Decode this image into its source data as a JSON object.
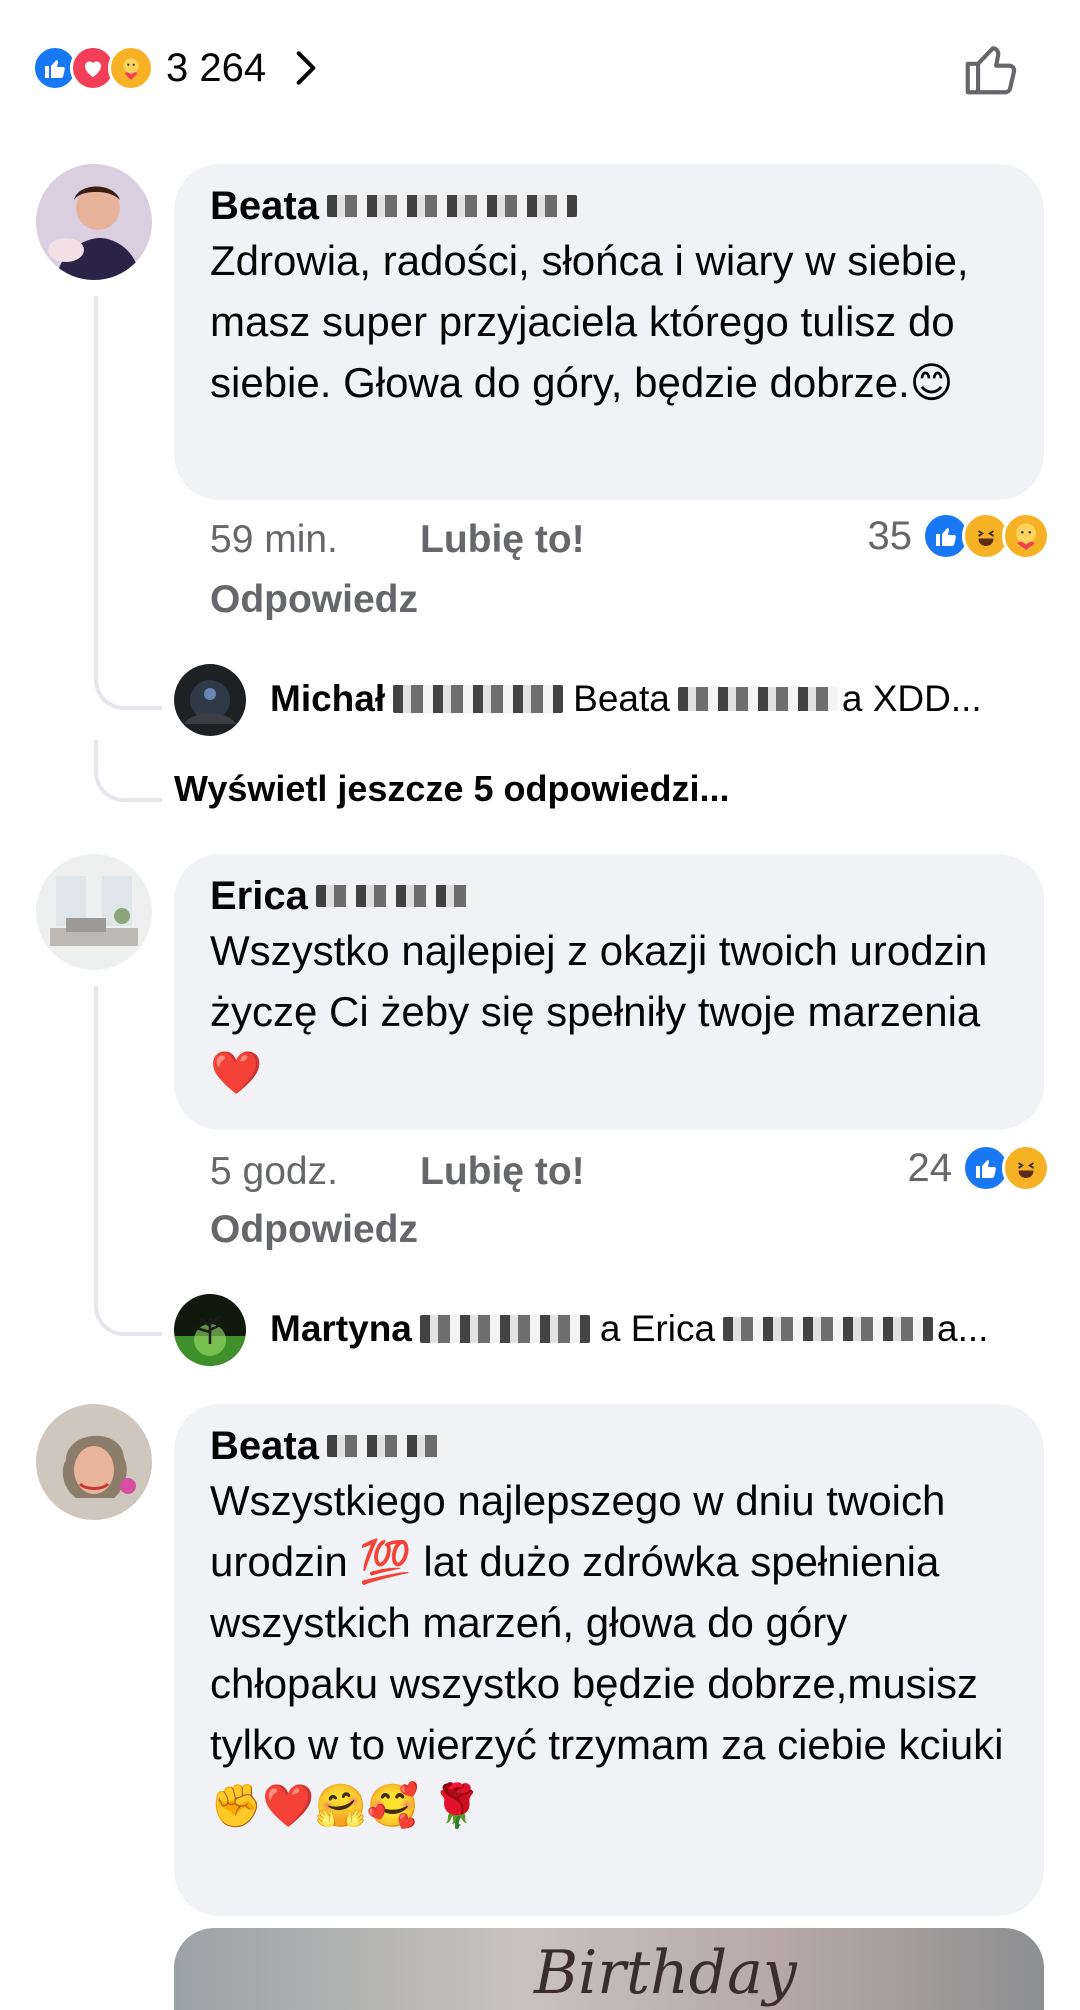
{
  "top": {
    "reaction_count": "3 264",
    "reaction_icons": [
      "like-icon",
      "love-icon",
      "care-icon"
    ]
  },
  "comments": [
    {
      "author": "Beata",
      "text": "Zdrowia, radości, słońca i wiary w siebie, masz super przyjaciela którego tulisz do siebie. Głowa do góry, będzie dobrze.😊",
      "time": "59 min.",
      "like_label": "Lubię to!",
      "reply_label": "Odpowiedz",
      "reaction_count": "35",
      "reply": {
        "name": "Michał",
        "text": "Beata",
        "tail": "a XDD..."
      },
      "more_replies": "Wyświetl jeszcze 5 odpowiedzi..."
    },
    {
      "author": "Erica",
      "text": "Wszystko najlepiej z okazji twoich urodzin życzę Ci żeby się spełniły twoje marzenia ❤️",
      "time": "5 godz.",
      "like_label": "Lubię to!",
      "reply_label": "Odpowiedz",
      "reaction_count": "24",
      "reply": {
        "name": "Martyna",
        "text": "a Erica",
        "tail": "a..."
      }
    },
    {
      "author": "Beata",
      "text": "Wszystkiego najlepszego w dniu twoich urodzin 💯 lat dużo zdrówka spełnienia wszystkich marzeń, głowa do góry chłopaku wszystko będzie dobrze,musisz tylko w to wierzyć trzymam za ciebie kciuki ✊❤️🤗🥰 🌹"
    }
  ],
  "photo_caption": "Birthday",
  "colors": {
    "like_blue": "#1877f2",
    "love_red": "#f33e58",
    "care_yellow": "#f7b125",
    "bubble": "#f0f2f5",
    "meta_gray": "#65676b"
  }
}
